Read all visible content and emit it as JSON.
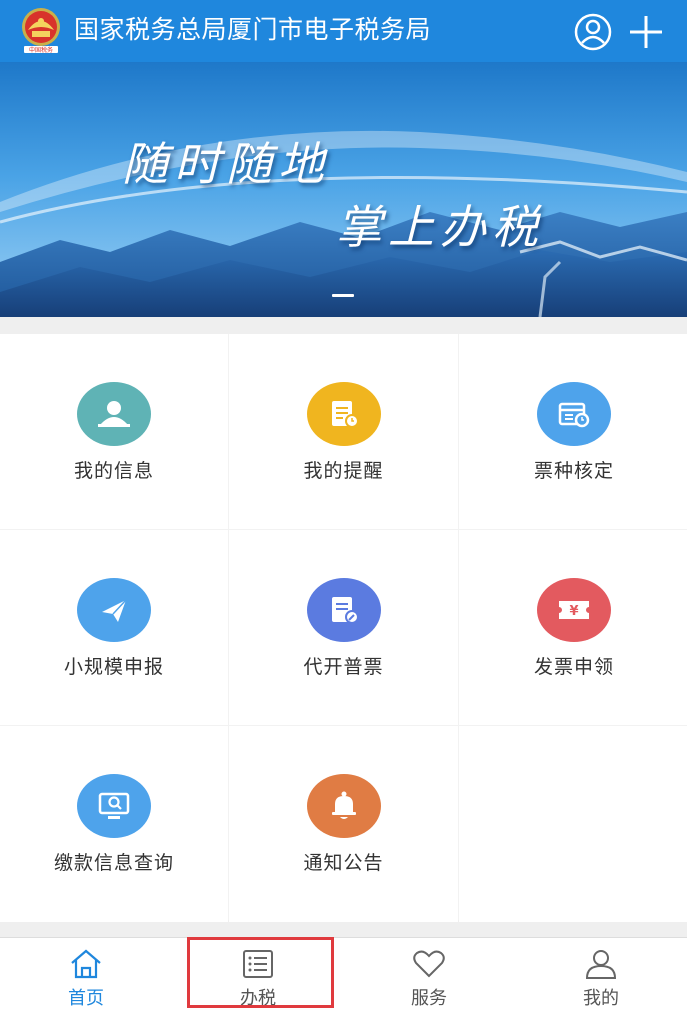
{
  "header": {
    "title": "国家税务总局厦门市电子税务局",
    "logo_text": "中国税务"
  },
  "banner": {
    "slogan_line1": "随时随地",
    "slogan_line2": "掌上办税"
  },
  "grid": {
    "items": [
      {
        "label": "我的信息",
        "icon": "user-card-icon",
        "color": "#5fb3b5"
      },
      {
        "label": "我的提醒",
        "icon": "reminder-doc-icon",
        "color": "#f0b51f"
      },
      {
        "label": "票种核定",
        "icon": "calendar-ticket-icon",
        "color": "#4ea3eb"
      },
      {
        "label": "小规模申报",
        "icon": "paper-plane-icon",
        "color": "#4ea3eb"
      },
      {
        "label": "代开普票",
        "icon": "edit-doc-icon",
        "color": "#5b7be0"
      },
      {
        "label": "发票申领",
        "icon": "yen-ticket-icon",
        "color": "#e35a5f"
      },
      {
        "label": "缴款信息查询",
        "icon": "monitor-search-icon",
        "color": "#4ea3eb"
      },
      {
        "label": "通知公告",
        "icon": "bell-icon",
        "color": "#e07c44"
      }
    ]
  },
  "bottom_nav": {
    "items": [
      {
        "label": "首页",
        "icon": "home-icon",
        "active": true
      },
      {
        "label": "办税",
        "icon": "list-icon",
        "active": false
      },
      {
        "label": "服务",
        "icon": "heart-icon",
        "active": false
      },
      {
        "label": "我的",
        "icon": "person-icon",
        "active": false
      }
    ],
    "active_color": "#1f87dd",
    "highlight_color": "#e03a3e"
  },
  "colors": {
    "header_bg": "#1f87dd"
  }
}
